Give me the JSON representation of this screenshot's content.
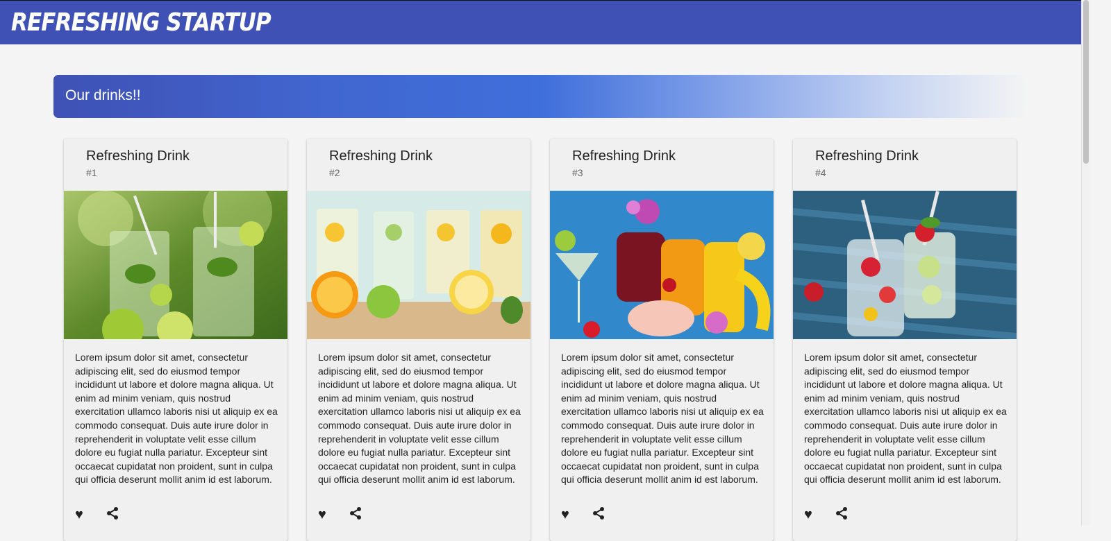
{
  "app": {
    "title": "Refreshing Startup"
  },
  "banner": {
    "title": "Our drinks!!"
  },
  "cards": [
    {
      "title": "Refreshing Drink",
      "subtitle": "#1",
      "image": "lime-mint-mojito-glasses",
      "text": "Lorem ipsum dolor sit amet, consectetur adipiscing elit, sed do eiusmod tempor incididunt ut labore et dolore magna aliqua. Ut enim ad minim veniam, quis nostrud exercitation ullamco laboris nisi ut aliquip ex ea commodo consequat. Duis aute irure dolor in reprehenderit in voluptate velit esse cillum dolore eu fugiat nulla pariatur. Excepteur sint occaecat cupidatat non proident, sunt in culpa qui officia deserunt mollit anim id est laborum.",
      "actions": [
        "favorite-icon",
        "share-icon"
      ]
    },
    {
      "title": "Refreshing Drink",
      "subtitle": "#2",
      "image": "citrus-cucumber-water-glasses",
      "text": "Lorem ipsum dolor sit amet, consectetur adipiscing elit, sed do eiusmod tempor incididunt ut labore et dolore magna aliqua. Ut enim ad minim veniam, quis nostrud exercitation ullamco laboris nisi ut aliquip ex ea commodo consequat. Duis aute irure dolor in reprehenderit in voluptate velit esse cillum dolore eu fugiat nulla pariatur. Excepteur sint occaecat cupidatat non proident, sunt in culpa qui officia deserunt mollit anim id est laborum.",
      "actions": [
        "favorite-icon",
        "share-icon"
      ]
    },
    {
      "title": "Refreshing Drink",
      "subtitle": "#3",
      "image": "tropical-cocktails-pool",
      "text": "Lorem ipsum dolor sit amet, consectetur adipiscing elit, sed do eiusmod tempor incididunt ut labore et dolore magna aliqua. Ut enim ad minim veniam, quis nostrud exercitation ullamco laboris nisi ut aliquip ex ea commodo consequat. Duis aute irure dolor in reprehenderit in voluptate velit esse cillum dolore eu fugiat nulla pariatur. Excepteur sint occaecat cupidatat non proident, sunt in culpa qui officia deserunt mollit anim id est laborum.",
      "actions": [
        "favorite-icon",
        "share-icon"
      ]
    },
    {
      "title": "Refreshing Drink",
      "subtitle": "#4",
      "image": "berry-infused-water-jars",
      "text": "Lorem ipsum dolor sit amet, consectetur adipiscing elit, sed do eiusmod tempor incididunt ut labore et dolore magna aliqua. Ut enim ad minim veniam, quis nostrud exercitation ullamco laboris nisi ut aliquip ex ea commodo consequat. Duis aute irure dolor in reprehenderit in voluptate velit esse cillum dolore eu fugiat nulla pariatur. Excepteur sint occaecat cupidatat non proident, sunt in culpa qui officia deserunt mollit anim id est laborum.",
      "actions": [
        "favorite-icon",
        "share-icon"
      ]
    }
  ],
  "colors": {
    "toolbar": "#3f51b5",
    "banner_accent": "#3f6fdb",
    "card_bg": "#f0f0f0",
    "page_bg": "#f4f4f4"
  }
}
